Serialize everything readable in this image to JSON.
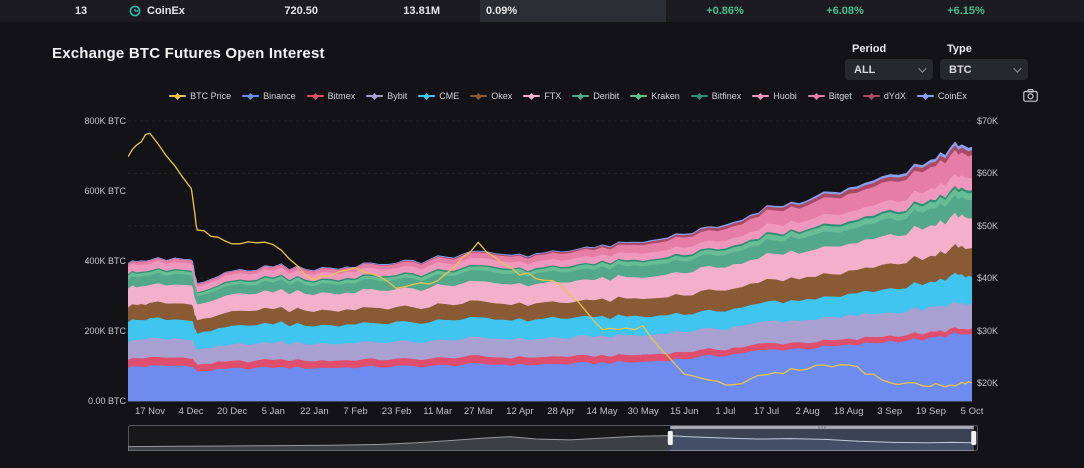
{
  "table_row": {
    "rank": "13",
    "exchange": "CoinEx",
    "price": "720.50",
    "volume": "13.81M",
    "open_interest_share": "0.09%",
    "change_1h": "+0.86%",
    "change_4h": "+6.08%",
    "change_24h": "+6.15%"
  },
  "header": {
    "title": "Exchange BTC Futures Open Interest",
    "period_label": "Period",
    "period_value": "ALL",
    "type_label": "Type",
    "type_value": "BTC"
  },
  "colors": {
    "page_bg": "#131317",
    "row_bg": "#1b1b20",
    "highlight_cell_bg": "#2c2c34",
    "positive_green": "#4cbd8f",
    "coinex_logo_teal": "#2ab9a6"
  },
  "chart_data": {
    "type": "area",
    "stacked": true,
    "title": "Exchange BTC Futures Open Interest",
    "x_tick_labels": [
      "17 Nov",
      "4 Dec",
      "20 Dec",
      "5 Jan",
      "22 Jan",
      "7 Feb",
      "23 Feb",
      "11 Mar",
      "27 Mar",
      "12 Apr",
      "28 Apr",
      "14 May",
      "30 May",
      "15 Jun",
      "1 Jul",
      "17 Jul",
      "2 Aug",
      "18 Aug",
      "3 Sep",
      "19 Sep",
      "5 Oct"
    ],
    "y_left_labels": [
      "800K BTC",
      "600K BTC",
      "400K BTC",
      "200K BTC",
      "0.00 BTC"
    ],
    "y_left_range_btc": [
      0,
      800000
    ],
    "y_right_labels": [
      "$70K",
      "$60K",
      "$50K",
      "$40K",
      "$30K",
      "$20K"
    ],
    "y_right_unit": "USD",
    "grid": "dashed horizontal at $10K steps",
    "legend_position": "top-center",
    "values_unit": "thousand BTC",
    "x_fractions": [
      0,
      0.026,
      0.075,
      0.082,
      0.123,
      0.172,
      0.22,
      0.269,
      0.318,
      0.367,
      0.415,
      0.464,
      0.513,
      0.562,
      0.61,
      0.659,
      0.708,
      0.757,
      0.805,
      0.854,
      0.903,
      0.951,
      0.98,
      1.0
    ],
    "series": [
      {
        "name": "Binance",
        "color": "#6e8cf0",
        "values": [
          98,
          100,
          102,
          86,
          92,
          97,
          95,
          97,
          99,
          101,
          106,
          104,
          106,
          110,
          112,
          122,
          132,
          146,
          152,
          158,
          172,
          178,
          192,
          188
        ]
      },
      {
        "name": "Bitmex",
        "color": "#df4f6d",
        "values": [
          24,
          24,
          23,
          19,
          21,
          22,
          21,
          21,
          21,
          21,
          22,
          21,
          21,
          20,
          20,
          19,
          18,
          18,
          17,
          17,
          16,
          16,
          15,
          15
        ]
      },
      {
        "name": "Bybit",
        "color": "#a9a0d2",
        "values": [
          52,
          53,
          54,
          44,
          48,
          50,
          48,
          49,
          50,
          51,
          53,
          52,
          53,
          55,
          56,
          58,
          60,
          62,
          64,
          66,
          68,
          70,
          73,
          72
        ]
      },
      {
        "name": "CME",
        "color": "#3fc5ef",
        "values": [
          58,
          57,
          55,
          47,
          52,
          54,
          52,
          53,
          55,
          56,
          58,
          55,
          56,
          55,
          54,
          50,
          52,
          55,
          58,
          62,
          68,
          72,
          80,
          78
        ]
      },
      {
        "name": "Okex",
        "color": "#8a5a34",
        "values": [
          44,
          45,
          45,
          37,
          40,
          42,
          41,
          42,
          43,
          44,
          46,
          45,
          46,
          48,
          50,
          55,
          58,
          62,
          64,
          66,
          70,
          74,
          81,
          80
        ]
      },
      {
        "name": "FTX",
        "color": "#f2b0ca",
        "values": [
          52,
          53,
          54,
          44,
          48,
          50,
          49,
          50,
          52,
          54,
          57,
          56,
          57,
          60,
          62,
          65,
          68,
          72,
          75,
          78,
          82,
          85,
          89,
          88
        ]
      },
      {
        "name": "Deribit",
        "color": "#53a78a",
        "values": [
          28,
          28,
          29,
          23,
          26,
          27,
          26,
          27,
          28,
          29,
          30,
          29,
          30,
          31,
          32,
          34,
          36,
          38,
          40,
          42,
          45,
          47,
          51,
          50
        ]
      },
      {
        "name": "Kraken",
        "color": "#67bd96",
        "values": [
          10,
          10,
          10,
          8,
          9,
          10,
          10,
          10,
          10,
          11,
          11,
          11,
          11,
          12,
          12,
          13,
          14,
          15,
          16,
          17,
          18,
          19,
          20,
          20
        ]
      },
      {
        "name": "Bitfinex",
        "color": "#2e8f74",
        "values": [
          4,
          4,
          4,
          3,
          4,
          4,
          4,
          4,
          4,
          4,
          4,
          4,
          4,
          4,
          4,
          5,
          5,
          5,
          5,
          6,
          6,
          6,
          7,
          7
        ]
      },
      {
        "name": "Huobi",
        "color": "#f097bd",
        "values": [
          20,
          20,
          21,
          16,
          18,
          19,
          18,
          18,
          19,
          19,
          20,
          19,
          19,
          20,
          20,
          21,
          22,
          24,
          26,
          28,
          30,
          32,
          35,
          34
        ]
      },
      {
        "name": "Bitget",
        "color": "#e57da6",
        "values": [
          8,
          8,
          9,
          6,
          8,
          9,
          10,
          11,
          12,
          14,
          15,
          16,
          18,
          20,
          24,
          28,
          32,
          38,
          44,
          50,
          55,
          60,
          66,
          64
        ]
      },
      {
        "name": "dYdX",
        "color": "#aa4a66",
        "values": [
          1,
          1,
          1,
          1,
          1,
          1,
          1,
          1,
          2,
          2,
          3,
          3,
          4,
          5,
          6,
          7,
          8,
          9,
          10,
          11,
          12,
          13,
          14,
          14
        ]
      },
      {
        "name": "CoinEx",
        "color": "#8ba1ef",
        "values": [
          0.5,
          0.5,
          0.5,
          0.5,
          0.5,
          0.5,
          1,
          1,
          1,
          1,
          1,
          1,
          1,
          1,
          2,
          2,
          3,
          3,
          4,
          5,
          6,
          7,
          8,
          8
        ]
      }
    ],
    "price_series": {
      "name": "BTC Price",
      "color": "#e8c44f",
      "unit": "thousand USD",
      "values": [
        63.5,
        68,
        57,
        49,
        47,
        46.5,
        39.5,
        42,
        38.5,
        39.5,
        46.5,
        41,
        39,
        30,
        30.5,
        22,
        19.5,
        21.5,
        23,
        23.5,
        20,
        19.5,
        19.5,
        20
      ]
    }
  },
  "navigator": {
    "selection_start_frac": 0.638,
    "selection_end_frac": 0.995,
    "spark": [
      [
        0,
        0.1
      ],
      [
        0.06,
        0.12
      ],
      [
        0.12,
        0.13
      ],
      [
        0.18,
        0.15
      ],
      [
        0.24,
        0.17
      ],
      [
        0.3,
        0.22
      ],
      [
        0.34,
        0.3
      ],
      [
        0.38,
        0.42
      ],
      [
        0.42,
        0.55
      ],
      [
        0.45,
        0.62
      ],
      [
        0.48,
        0.5
      ],
      [
        0.52,
        0.45
      ],
      [
        0.56,
        0.55
      ],
      [
        0.6,
        0.65
      ],
      [
        0.638,
        0.68
      ],
      [
        0.66,
        0.62
      ],
      [
        0.7,
        0.55
      ],
      [
        0.74,
        0.5
      ],
      [
        0.78,
        0.52
      ],
      [
        0.82,
        0.48
      ],
      [
        0.86,
        0.38
      ],
      [
        0.9,
        0.32
      ],
      [
        0.94,
        0.3
      ],
      [
        0.97,
        0.32
      ],
      [
        1.0,
        0.3
      ]
    ]
  }
}
